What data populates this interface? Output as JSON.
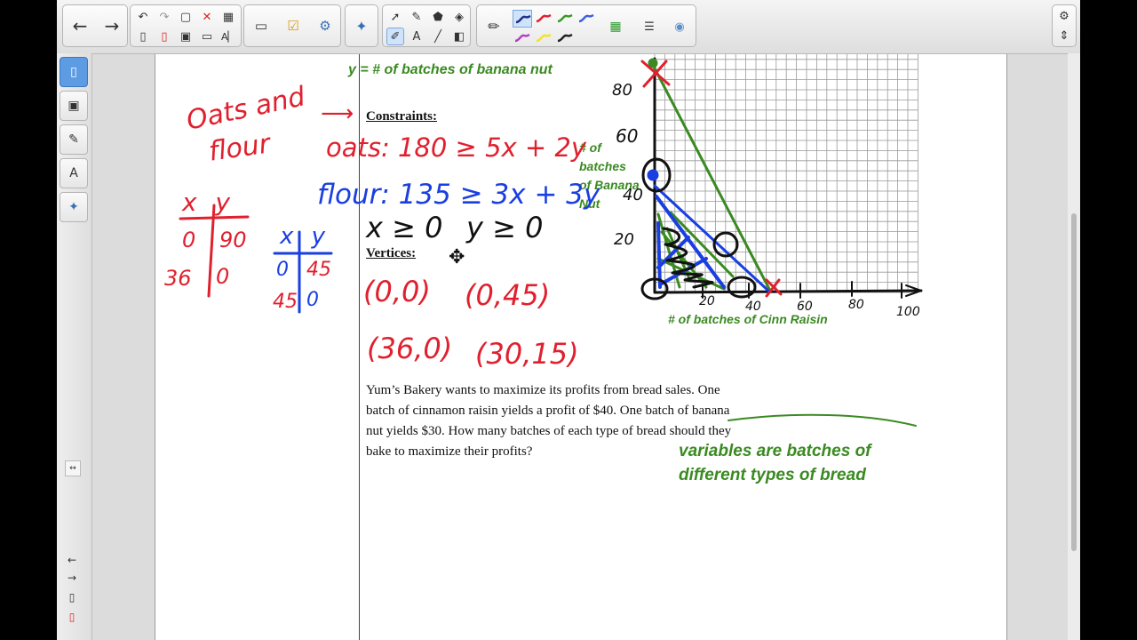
{
  "toolbar": {
    "icons": [
      "back-arrow-icon",
      "forward-arrow-icon",
      "undo-icon",
      "redo-icon",
      "new-page-icon",
      "delete-icon",
      "table-icon",
      "screen-shade-icon",
      "check-icon",
      "puzzle-icon",
      "select-arrow-icon",
      "pen-icon",
      "highlighter-icon",
      "eraser-icon",
      "line-icon",
      "settings-icon"
    ],
    "pen_colors": [
      "#1b2f8a",
      "#e0202e",
      "#3a9a25",
      "#3b5fe0",
      "#b040c0",
      "#f2e51d",
      "#222222"
    ]
  },
  "sidebar": {
    "tabs": [
      "page-sorter",
      "gallery",
      "attachments",
      "properties",
      "add-ons"
    ],
    "nav": [
      "←",
      "→"
    ]
  },
  "document": {
    "heading_var": "y = # of batches of banana nut",
    "constraints_label": "Constraints:",
    "vertices_label": "Vertices:",
    "problem_text": "Yum’s Bakery wants to maximize its profits from bread sales. One batch of cinnamon raisin yields a profit of $40. One batch of banana nut yields $30. How many batches of each type of bread should they bake to maximize their profits?",
    "note_line1": "variables are batches of",
    "note_line2": "different types of bread",
    "y_axis_label": [
      "# of",
      "batches",
      "of Banana",
      "Nut"
    ],
    "x_axis_label": "# of batches of Cinn Raisin"
  },
  "handwriting": {
    "oats_and_flour_1": "Oats and",
    "oats_and_flour_2": "flour",
    "oats_constraint": "oats: 180 ≥ 5x + 2y",
    "flour_constraint": "flour: 135 ≥ 3x + 3y",
    "nonneg_x": "x ≥ 0",
    "nonneg_y": "y ≥ 0",
    "red_table_header": "x y",
    "red_table_rows": [
      [
        "0",
        "90"
      ],
      [
        "36",
        "0"
      ]
    ],
    "blue_table_header": "x y",
    "blue_table_rows": [
      [
        "0",
        "45"
      ],
      [
        "45",
        "0"
      ]
    ],
    "vertex_1": "(0,0)",
    "vertex_2": "(0,45)",
    "vertex_3": "(36,0)",
    "vertex_4": "(30,15)",
    "y_ticks": [
      "80",
      "60",
      "40",
      "20"
    ],
    "x_ticks": [
      "20",
      "40",
      "60",
      "80",
      "100"
    ]
  }
}
